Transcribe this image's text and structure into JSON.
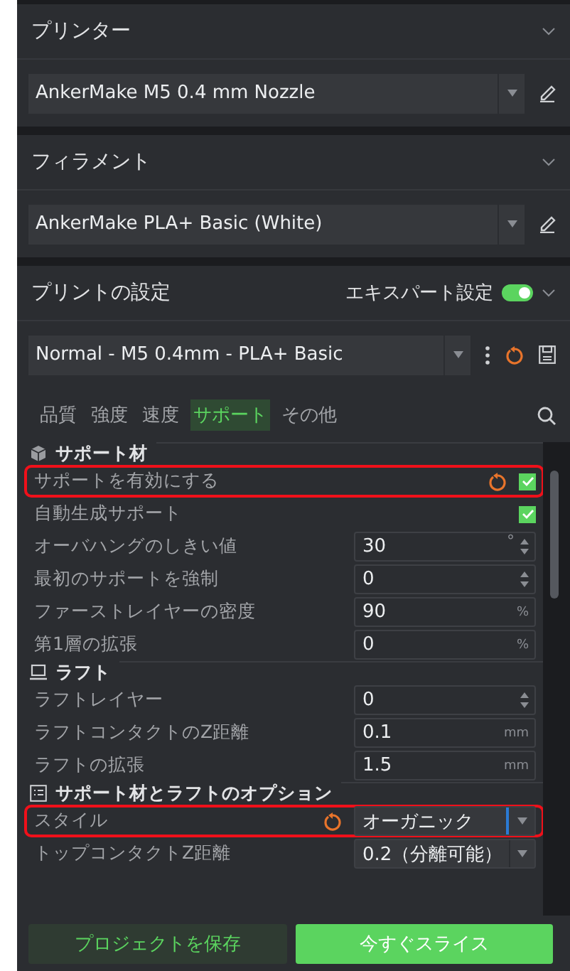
{
  "printer": {
    "title": "プリンター",
    "preset": "AnkerMake M5 0.4 mm Nozzle"
  },
  "filament": {
    "title": "フィラメント",
    "preset": "AnkerMake PLA+ Basic (White)"
  },
  "print_settings": {
    "title": "プリントの設定",
    "expert_label": "エキスパート設定",
    "expert_on": true,
    "preset": "Normal - M5 0.4mm - PLA+ Basic",
    "tabs": [
      {
        "label": "品質",
        "selected": false
      },
      {
        "label": "強度",
        "selected": false
      },
      {
        "label": "速度",
        "selected": false
      },
      {
        "label": "サポート",
        "selected": true
      },
      {
        "label": "その他",
        "selected": false
      }
    ],
    "rows": [
      {
        "kind": "section",
        "label": "サポート材"
      },
      {
        "kind": "check",
        "label": "サポートを有効にする",
        "checked": true,
        "modified": true,
        "highlighted": true
      },
      {
        "kind": "check",
        "label": "自動生成サポート",
        "checked": true,
        "modified": false,
        "highlighted": false
      },
      {
        "kind": "spin",
        "label": "オーバハングのしきい値",
        "value": "30",
        "unit": "°",
        "modified": false,
        "highlighted": false
      },
      {
        "kind": "spin",
        "label": "最初のサポートを強制",
        "value": "0",
        "modified": false,
        "highlighted": false
      },
      {
        "kind": "unit",
        "label": "ファーストレイヤーの密度",
        "value": "90",
        "unit": "%",
        "modified": false,
        "highlighted": false
      },
      {
        "kind": "unit",
        "label": "第1層の拡張",
        "value": "0",
        "unit": "%",
        "modified": false,
        "highlighted": false
      },
      {
        "kind": "section",
        "label": "ラフト"
      },
      {
        "kind": "spin",
        "label": "ラフトレイヤー",
        "value": "0",
        "modified": false,
        "highlighted": false
      },
      {
        "kind": "unit",
        "label": "ラフトコンタクトのZ距離",
        "value": "0.1",
        "unit": "mm",
        "modified": false,
        "highlighted": false
      },
      {
        "kind": "unit",
        "label": "ラフトの拡張",
        "value": "1.5",
        "unit": "mm",
        "modified": false,
        "highlighted": false
      },
      {
        "kind": "section",
        "label": "サポート材とラフトのオプション"
      },
      {
        "kind": "select",
        "label": "スタイル",
        "value": "オーガニック",
        "modified": true,
        "highlighted": true
      },
      {
        "kind": "select",
        "label": "トップコンタクトZ距離",
        "value": "0.2（分離可能）",
        "modified": false,
        "highlighted": false
      }
    ]
  },
  "buttons": {
    "save": "プロジェクトを保存",
    "slice": "今すぐスライス"
  }
}
